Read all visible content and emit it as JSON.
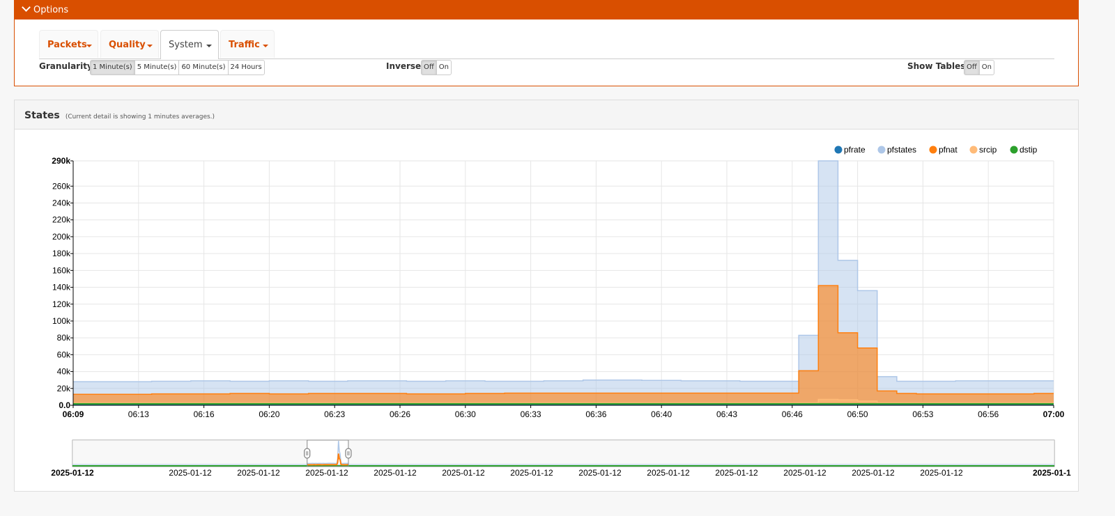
{
  "options": {
    "title": "Options",
    "tabs": [
      {
        "label": "Packets",
        "active": false
      },
      {
        "label": "Quality",
        "active": false
      },
      {
        "label": "System",
        "active": true
      },
      {
        "label": "Traffic",
        "active": false
      }
    ],
    "granularity": {
      "label": "Granularity:",
      "buttons": [
        "1 Minute(s)",
        "5 Minute(s)",
        "60 Minute(s)",
        "24 Hours"
      ],
      "selected": "1 Minute(s)"
    },
    "inverse": {
      "label": "Inverse:",
      "buttons": [
        "Off",
        "On"
      ],
      "selected": "Off"
    },
    "show_tables": {
      "label": "Show Tables:",
      "buttons": [
        "Off",
        "On"
      ],
      "selected": "Off"
    }
  },
  "states_panel": {
    "title": "States",
    "note": "(Current detail is showing 1 minutes averages.)"
  },
  "colors": {
    "accent": "#d94f00",
    "pfrate": "#1f77b4",
    "pfstates": "#aec7e8",
    "pfnat": "#ff7f0e",
    "srcip": "#ffbb78",
    "dstip": "#2ca02c"
  },
  "chart_data": {
    "type": "area",
    "legend_position": "top-right",
    "legend": [
      "pfrate",
      "pfstates",
      "pfnat",
      "srcip",
      "dstip"
    ],
    "ylim": [
      0,
      290000
    ],
    "y_ticks": [
      "0.0",
      "20k",
      "40k",
      "60k",
      "80k",
      "100k",
      "120k",
      "140k",
      "160k",
      "180k",
      "200k",
      "220k",
      "240k",
      "260k",
      "290k"
    ],
    "x_ticks": [
      "06:09",
      "06:13",
      "06:16",
      "06:20",
      "06:23",
      "06:26",
      "06:30",
      "06:33",
      "06:36",
      "06:40",
      "06:43",
      "06:46",
      "06:50",
      "06:53",
      "06:56",
      "07:00"
    ],
    "x_start_label": "06:09",
    "x_end_label": "07:00",
    "num_points": 51,
    "series": [
      {
        "name": "pfstates",
        "values": [
          28000,
          28000,
          28000,
          28000,
          28500,
          28500,
          29000,
          29000,
          28500,
          28500,
          29000,
          29000,
          28500,
          28500,
          29000,
          29000,
          29000,
          28500,
          28500,
          29000,
          29000,
          28500,
          28500,
          28500,
          29000,
          29000,
          30000,
          30000,
          30000,
          29500,
          29500,
          29000,
          29000,
          29000,
          28500,
          28500,
          28500,
          83000,
          290000,
          172000,
          136000,
          34000,
          28500,
          28500,
          28500,
          29000,
          29000,
          29000,
          29000,
          29000,
          29000
        ]
      },
      {
        "name": "pfnat",
        "values": [
          13000,
          13000,
          13000,
          13000,
          13500,
          13500,
          13500,
          13500,
          14000,
          14000,
          13500,
          13500,
          14000,
          14000,
          14000,
          14000,
          14000,
          13500,
          13500,
          13500,
          14000,
          14000,
          14500,
          14500,
          14500,
          14500,
          14500,
          14500,
          14500,
          14500,
          14500,
          14500,
          14500,
          14500,
          14500,
          14500,
          14500,
          41000,
          142000,
          86000,
          68000,
          17000,
          14000,
          13500,
          13500,
          13500,
          13500,
          13500,
          13500,
          14000,
          14000
        ]
      },
      {
        "name": "srcip",
        "values": [
          3000,
          3000,
          3000,
          3000,
          3000,
          3000,
          3000,
          3000,
          3000,
          3000,
          3000,
          3000,
          3000,
          3000,
          3000,
          3000,
          3000,
          3000,
          3000,
          3000,
          3000,
          3000,
          3000,
          3000,
          3000,
          3000,
          3000,
          3000,
          3000,
          3000,
          3000,
          3000,
          3000,
          3000,
          3000,
          3000,
          3000,
          3000,
          7000,
          6500,
          5000,
          3000,
          3000,
          3000,
          3000,
          3000,
          3000,
          3000,
          3000,
          3000,
          3000
        ]
      },
      {
        "name": "dstip",
        "values": [
          1500,
          1500,
          1500,
          1500,
          1500,
          1500,
          1500,
          1500,
          1500,
          1500,
          1500,
          1500,
          1500,
          1500,
          1500,
          1500,
          1500,
          1500,
          1500,
          1500,
          1500,
          1500,
          1500,
          1500,
          1500,
          1500,
          1500,
          1500,
          1500,
          1500,
          1500,
          1500,
          1500,
          1500,
          1500,
          1500,
          1500,
          1500,
          1500,
          1500,
          1500,
          1500,
          1500,
          1500,
          1500,
          1500,
          1500,
          1500,
          1500,
          1500,
          1500
        ]
      },
      {
        "name": "pfrate",
        "values": [
          200,
          200,
          200,
          200,
          200,
          200,
          200,
          200,
          200,
          200,
          200,
          200,
          200,
          200,
          200,
          200,
          200,
          200,
          200,
          200,
          200,
          200,
          200,
          200,
          200,
          200,
          200,
          200,
          200,
          200,
          200,
          200,
          200,
          200,
          200,
          200,
          200,
          200,
          200,
          200,
          200,
          200,
          200,
          200,
          200,
          200,
          200,
          200,
          200,
          200,
          200
        ]
      }
    ],
    "overview": {
      "x_ticks": [
        "2025-01-12",
        "2025-01-12",
        "2025-01-12",
        "2025-01-12",
        "2025-01-12",
        "2025-01-12",
        "2025-01-12",
        "2025-01-12",
        "2025-01-12",
        "2025-01-12",
        "2025-01-12",
        "2025-01-12",
        "2025-01-12",
        "2025-01-1"
      ],
      "brush_range_fraction": [
        0.239,
        0.281
      ]
    }
  }
}
